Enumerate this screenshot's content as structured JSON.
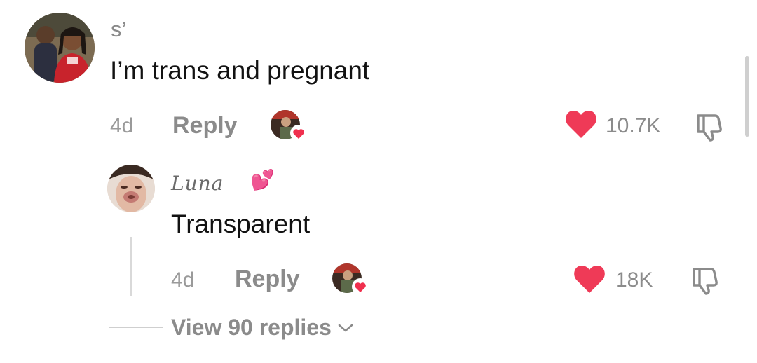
{
  "comment": {
    "username": "s’",
    "text": "I’m trans and pregnant",
    "time": "4d",
    "reply_label": "Reply",
    "like_count": "10.7K",
    "avatar_icon": "profile-photo-two-people",
    "creator_liked_icon": "creator-avatar-heart-badge"
  },
  "reply": {
    "username": "Luna",
    "emoji": "💕",
    "text": "Transparent",
    "time": "4d",
    "reply_label": "Reply",
    "like_count": "18K",
    "avatar_icon": "profile-photo-face"
  },
  "view_replies": {
    "label": "View 90 replies",
    "chevron_icon": "chevron-down-icon"
  },
  "colors": {
    "like_heart": "#ef3a57",
    "muted_text": "#8b8b8b",
    "badge_heart": "#f0304e"
  }
}
